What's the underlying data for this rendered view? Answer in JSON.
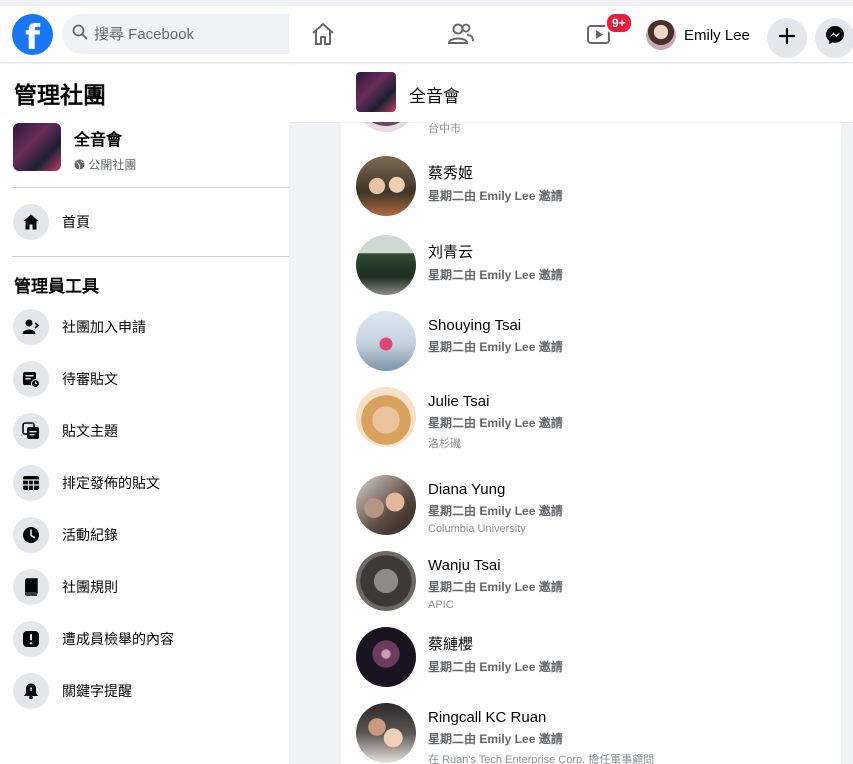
{
  "topbar": {
    "search_placeholder": "搜尋 Facebook",
    "notification_badge": "9+",
    "user_name": "Emily Lee",
    "icons": [
      "facebook-logo",
      "search-icon",
      "home-icon",
      "friends-icon",
      "watch-icon",
      "plus-icon",
      "messenger-icon"
    ]
  },
  "sidebar": {
    "title": "管理社團",
    "group": {
      "name": "全音會",
      "privacy": "公開社團"
    },
    "home_label": "首頁",
    "admin_tools_title": "管理員工具",
    "items": [
      {
        "label": "社團加入申請",
        "icon": "member-request-icon"
      },
      {
        "label": "待審貼文",
        "icon": "pending-posts-icon"
      },
      {
        "label": "貼文主題",
        "icon": "post-topics-icon"
      },
      {
        "label": "排定發佈的貼文",
        "icon": "scheduled-posts-icon"
      },
      {
        "label": "活動紀錄",
        "icon": "clock-icon"
      },
      {
        "label": "社團規則",
        "icon": "book-icon"
      },
      {
        "label": "遭成員檢舉的內容",
        "icon": "report-icon"
      },
      {
        "label": "關鍵字提醒",
        "icon": "bell-icon"
      }
    ]
  },
  "group_header": {
    "name": "全音會"
  },
  "members": [
    {
      "name": "",
      "invite": "",
      "extra": "台中市"
    },
    {
      "name": "蔡秀姬",
      "invite": "星期二由 Emily Lee 邀請",
      "extra": ""
    },
    {
      "name": "刘青云",
      "invite": "星期二由 Emily Lee 邀請",
      "extra": ""
    },
    {
      "name": "Shouying Tsai",
      "invite": "星期二由 Emily Lee 邀請",
      "extra": ""
    },
    {
      "name": "Julie Tsai",
      "invite": "星期二由 Emily Lee 邀請",
      "extra": "洛杉磯"
    },
    {
      "name": "Diana Yung",
      "invite": "星期二由 Emily Lee 邀請",
      "extra": "Columbia University"
    },
    {
      "name": "Wanju Tsai",
      "invite": "星期二由 Emily Lee 邀請",
      "extra": "APIC"
    },
    {
      "name": "蔡縺櫻",
      "invite": "星期二由 Emily Lee 邀請",
      "extra": ""
    },
    {
      "name": "Ringcall KC Ruan",
      "invite": "星期二由 Emily Lee 邀請",
      "extra": "在 Ruan's Tech Enterprise Corp. 擔任軍事顧問"
    }
  ],
  "colors": {
    "accent": "#1877f2",
    "badge": "#e41e3f",
    "secondary_text": "#65676b"
  }
}
